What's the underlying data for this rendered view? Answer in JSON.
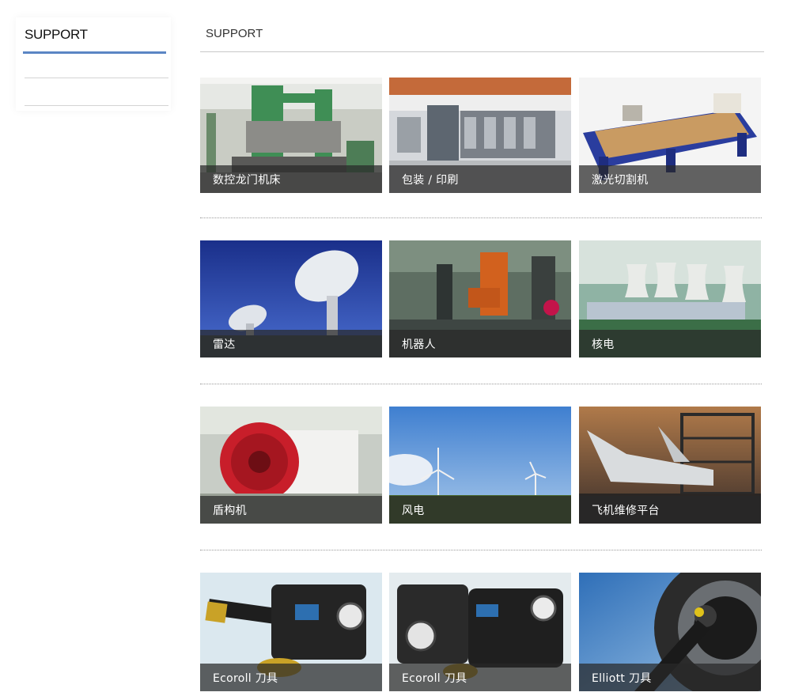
{
  "sidebar": {
    "title": "SUPPORT"
  },
  "main": {
    "title": "SUPPORT"
  },
  "categories": [
    {
      "label": "数控龙门机床"
    },
    {
      "label": "包装 / 印刷"
    },
    {
      "label": "激光切割机"
    },
    {
      "label": "雷达"
    },
    {
      "label": "机器人"
    },
    {
      "label": "核电"
    },
    {
      "label": "盾构机"
    },
    {
      "label": "风电"
    },
    {
      "label": "飞机维修平台"
    },
    {
      "label": "Ecoroll 刀具"
    },
    {
      "label": "Ecoroll 刀具"
    },
    {
      "label": "Elliott 刀具"
    }
  ],
  "colors": {
    "accent": "#5b86c4",
    "caption_bg": "#333333"
  }
}
